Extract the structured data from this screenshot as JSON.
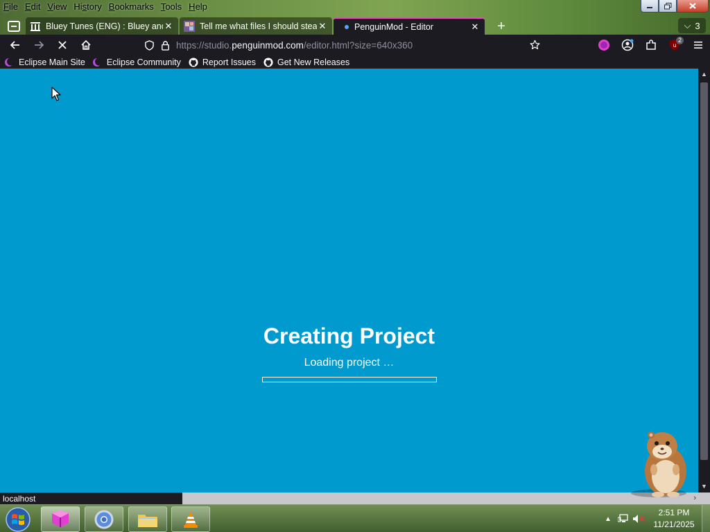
{
  "menu": [
    "File",
    "Edit",
    "View",
    "History",
    "Bookmarks",
    "Tools",
    "Help"
  ],
  "menu_mnemonics": [
    "F",
    "E",
    "V",
    "H",
    "B",
    "T",
    "H"
  ],
  "tabs": [
    {
      "title": "Bluey Tunes (ENG) : Bluey and A",
      "icon": "archive-icon"
    },
    {
      "title": "Tell me what files I should steal ·",
      "icon": "thumbnail-icon"
    },
    {
      "title": "PenguinMod - Editor",
      "icon": "loading-dot-icon"
    }
  ],
  "tab_count": "3",
  "url": {
    "prefix": "https://studio.",
    "domain": "penguinmod.com",
    "path": "/editor.html?size=640x360"
  },
  "extension_badge": "2",
  "bookmarks": [
    {
      "label": "Eclipse Main Site",
      "icon": "eclipse-icon"
    },
    {
      "label": "Eclipse Community",
      "icon": "eclipse-icon"
    },
    {
      "label": "Report Issues",
      "icon": "github-icon"
    },
    {
      "label": "Get New Releases",
      "icon": "github-icon"
    }
  ],
  "loader": {
    "title": "Creating Project",
    "subtitle": "Loading project …",
    "progress": 0
  },
  "status": "localhost",
  "clock": {
    "time": "2:51 PM",
    "date": "11/21/2025"
  },
  "colors": {
    "page_bg": "#009ace",
    "browser_bg": "#1c1b22",
    "active_tab_accent": "#ff3dcd"
  }
}
